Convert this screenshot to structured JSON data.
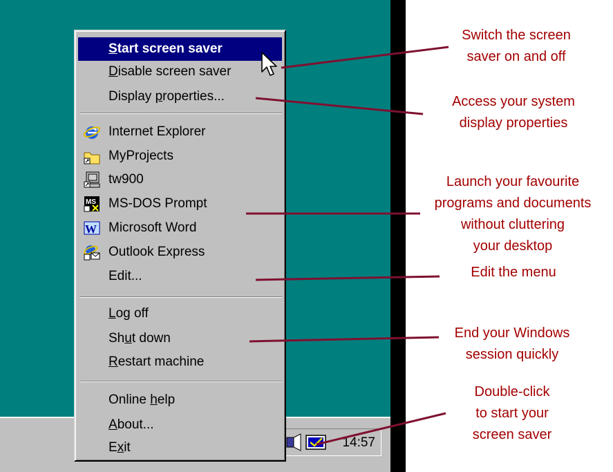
{
  "menu": {
    "items": [
      {
        "name": "start-screen-saver",
        "label": "Start screen saver",
        "icon": null,
        "highlighted": true
      },
      {
        "name": "disable-screen-saver",
        "label": "Disable screen saver",
        "icon": null
      },
      {
        "name": "display-properties",
        "label": "Display properties...",
        "icon": null
      },
      {
        "name": "internet-explorer",
        "label": "Internet Explorer",
        "icon": "internet-explorer-icon"
      },
      {
        "name": "myprojects",
        "label": "MyProjects",
        "icon": "folder-shortcut-icon"
      },
      {
        "name": "tw900",
        "label": "tw900",
        "icon": "computer-shortcut-icon"
      },
      {
        "name": "ms-dos-prompt",
        "label": "MS-DOS Prompt",
        "icon": "ms-dos-icon"
      },
      {
        "name": "microsoft-word",
        "label": "Microsoft Word",
        "icon": "word-icon"
      },
      {
        "name": "outlook-express",
        "label": "Outlook Express",
        "icon": "outlook-express-icon"
      },
      {
        "name": "edit",
        "label": "Edit...",
        "icon": null
      },
      {
        "name": "log-off",
        "label": "Log off",
        "icon": null
      },
      {
        "name": "shut-down",
        "label": "Shut down",
        "icon": null
      },
      {
        "name": "restart-machine",
        "label": "Restart machine",
        "icon": null
      },
      {
        "name": "online-help",
        "label": "Online help",
        "icon": null
      },
      {
        "name": "about",
        "label": "About...",
        "icon": null
      },
      {
        "name": "exit",
        "label": "Exit",
        "icon": null
      }
    ]
  },
  "tray": {
    "clock": "14:57",
    "icons": [
      "speaker-icon",
      "screen-saver-tray-icon"
    ]
  },
  "callouts": [
    {
      "name": "callout-switch",
      "text": "Switch the screen\nsaver on and off"
    },
    {
      "name": "callout-display",
      "text": "Access your system\ndisplay properties"
    },
    {
      "name": "callout-launch",
      "text": "Launch your favourite\nprograms and documents\nwithout cluttering\nyour desktop"
    },
    {
      "name": "callout-edit",
      "text": "Edit the menu"
    },
    {
      "name": "callout-end",
      "text": "End your Windows\nsession quickly"
    },
    {
      "name": "callout-double",
      "text": "Double-click\nto start your\nscreen saver"
    }
  ],
  "colors": {
    "desktop": "#007f7f",
    "menu_bg": "#c0c0c0",
    "highlight": "#000080",
    "callout_text": "#a30000",
    "leader_line": "#7f1030"
  }
}
